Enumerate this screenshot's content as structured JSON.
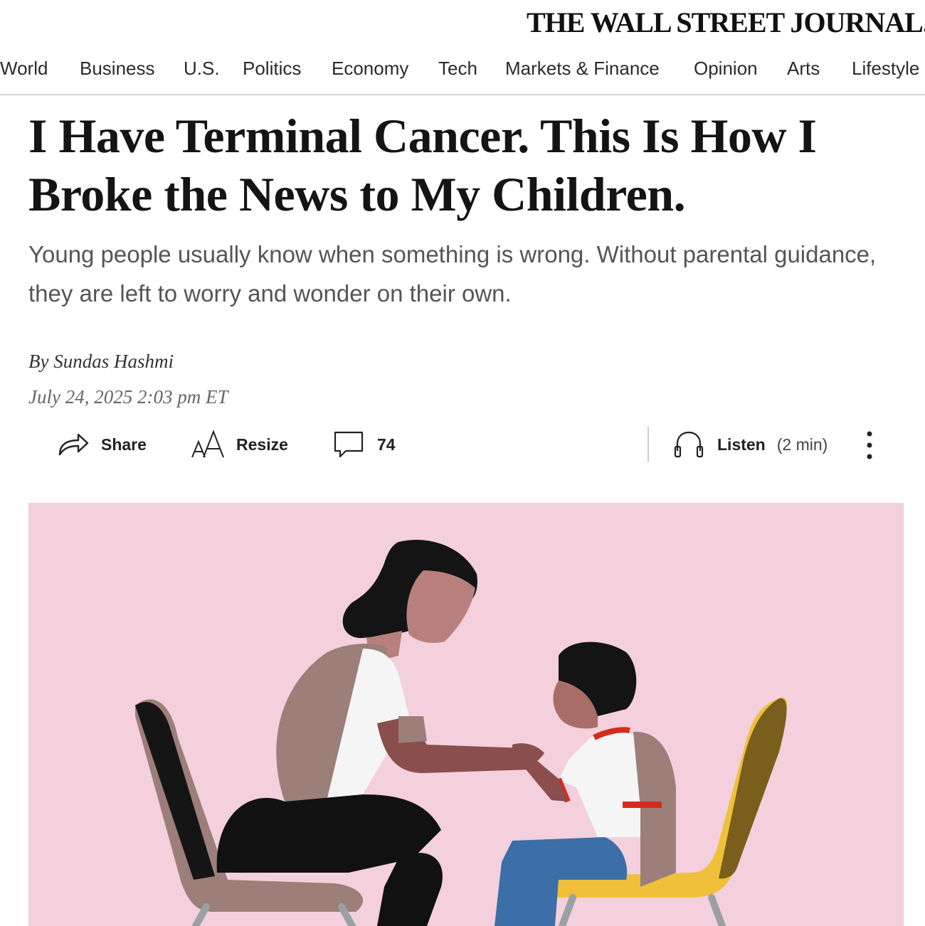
{
  "masthead": {
    "title": "THE WALL STREET JOURNAL."
  },
  "nav": {
    "items": [
      "World",
      "Business",
      "U.S.",
      "Politics",
      "Economy",
      "Tech",
      "Markets & Finance",
      "Opinion",
      "Arts",
      "Lifestyle"
    ]
  },
  "article": {
    "headline": "I Have Terminal Cancer. This Is How I Broke the News to My Children.",
    "dek": "Young people usually know when something is wrong. Without parental guidance, they are left to worry and wonder on their own.",
    "byline_prefix": "By",
    "author": "Sundas Hashmi",
    "date": "July 24, 2025 2:03 pm ET"
  },
  "toolbar": {
    "share_label": "Share",
    "resize_label": "Resize",
    "comments_count": "74",
    "listen_label": "Listen",
    "listen_duration": "(2 min)"
  },
  "icons": {
    "share": "share-arrow-icon",
    "resize": "text-resize-icon",
    "comments": "comment-bubble-icon",
    "listen": "headphones-icon",
    "more": "vertical-ellipsis-icon"
  },
  "colors": {
    "hero_background": "#f3d0dc",
    "chair_left": "#9b7f78",
    "chair_right": "#f0c03a",
    "nav_rule": "#d4d4d4"
  }
}
